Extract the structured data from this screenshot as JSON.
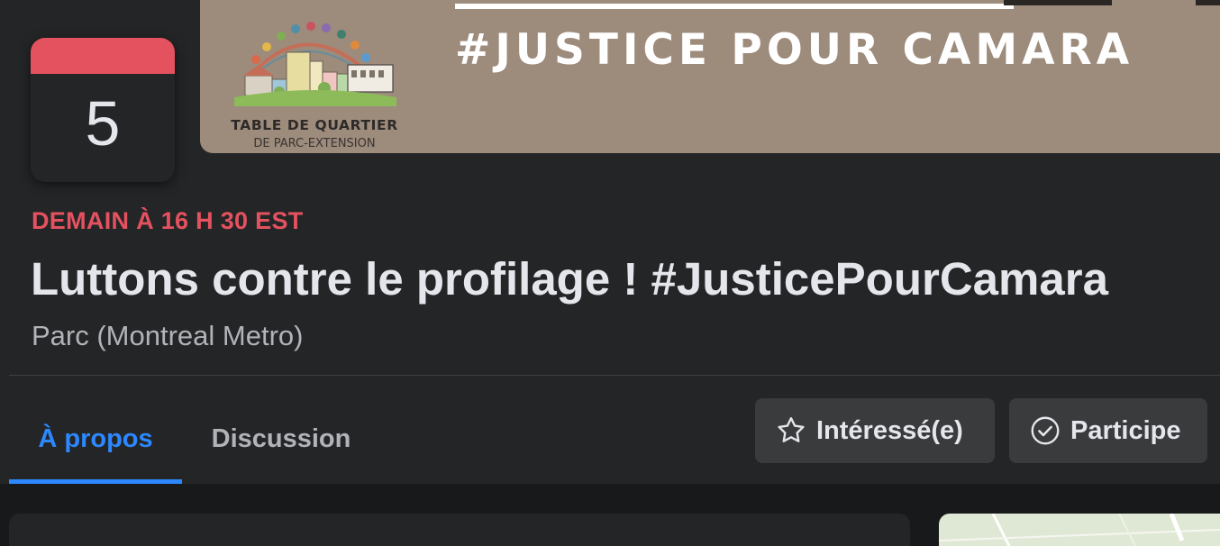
{
  "cover": {
    "hashtag": "#JUSTICE POUR CAMARA",
    "logo_title": "TABLE DE QUARTIER",
    "logo_subtitle": "DE PARC-EXTENSION"
  },
  "calendar": {
    "day": "5"
  },
  "event": {
    "date_time": "DEMAIN À 16 H 30 EST",
    "title": "Luttons contre le profilage ! #JusticePourCamara",
    "location": "Parc (Montreal Metro)"
  },
  "tabs": [
    {
      "label": "À propos",
      "active": true
    },
    {
      "label": "Discussion",
      "active": false
    }
  ],
  "actions": {
    "interested": {
      "label": "Intéressé(e)",
      "icon": "star-icon"
    },
    "going": {
      "label": "Participe",
      "icon": "check-circle-icon"
    }
  },
  "colors": {
    "accent": "#2d88ff",
    "date_red": "#e4515f",
    "cover_bg": "#9d8b7c",
    "surface": "#242526",
    "button_bg": "#3a3b3c"
  }
}
